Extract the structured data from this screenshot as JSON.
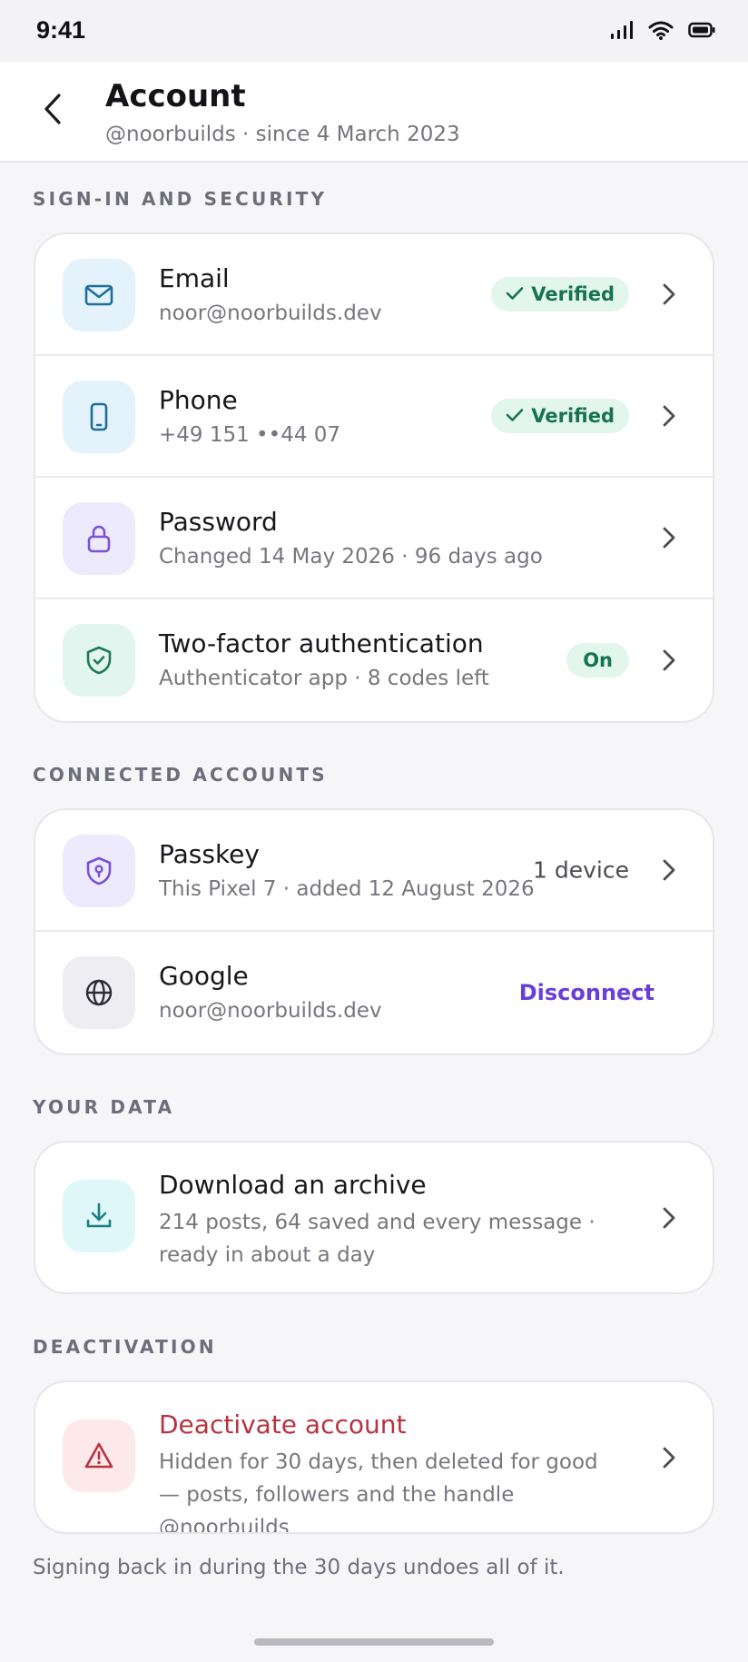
{
  "status_bar": {
    "time": "9:41"
  },
  "header": {
    "title": "Account",
    "subtitle": "@noorbuilds · since 4 March 2023"
  },
  "sections": {
    "security": {
      "label": "SIGN-IN AND SECURITY",
      "email": {
        "label": "Email",
        "desc": "noor@noorbuilds.dev",
        "badge": "Verified"
      },
      "phone": {
        "label": "Phone",
        "desc": "+49 151 ••44 07",
        "badge": "Verified"
      },
      "password": {
        "label": "Password",
        "desc": "Changed 14 May 2026 · 96 days ago"
      },
      "twofa": {
        "label": "Two-factor authentication",
        "desc": "Authenticator app · 8 codes left",
        "badge": "On"
      }
    },
    "connected": {
      "label": "CONNECTED ACCOUNTS",
      "passkey": {
        "label": "Passkey",
        "desc": "This Pixel 7 · added 12 August 2026",
        "trailing": "1 device"
      },
      "google": {
        "label": "Google",
        "desc": "noor@noorbuilds.dev",
        "action": "Disconnect"
      }
    },
    "data": {
      "label": "YOUR DATA",
      "archive": {
        "label": "Download an archive",
        "desc": "214 posts, 64 saved and every message · ready in about a day"
      }
    },
    "deactivation": {
      "label": "DEACTIVATION",
      "deactivate": {
        "label": "Deactivate account",
        "desc": "Hidden for 30 days, then deleted for good — posts, followers and the handle @noorbuilds"
      }
    }
  },
  "footnote": "Signing back in during the 30 days undoes all of it.",
  "colors": {
    "accent": "#6a3fd8",
    "danger": "#b83341",
    "success": "#17734f",
    "background": "#f6f6f8"
  }
}
